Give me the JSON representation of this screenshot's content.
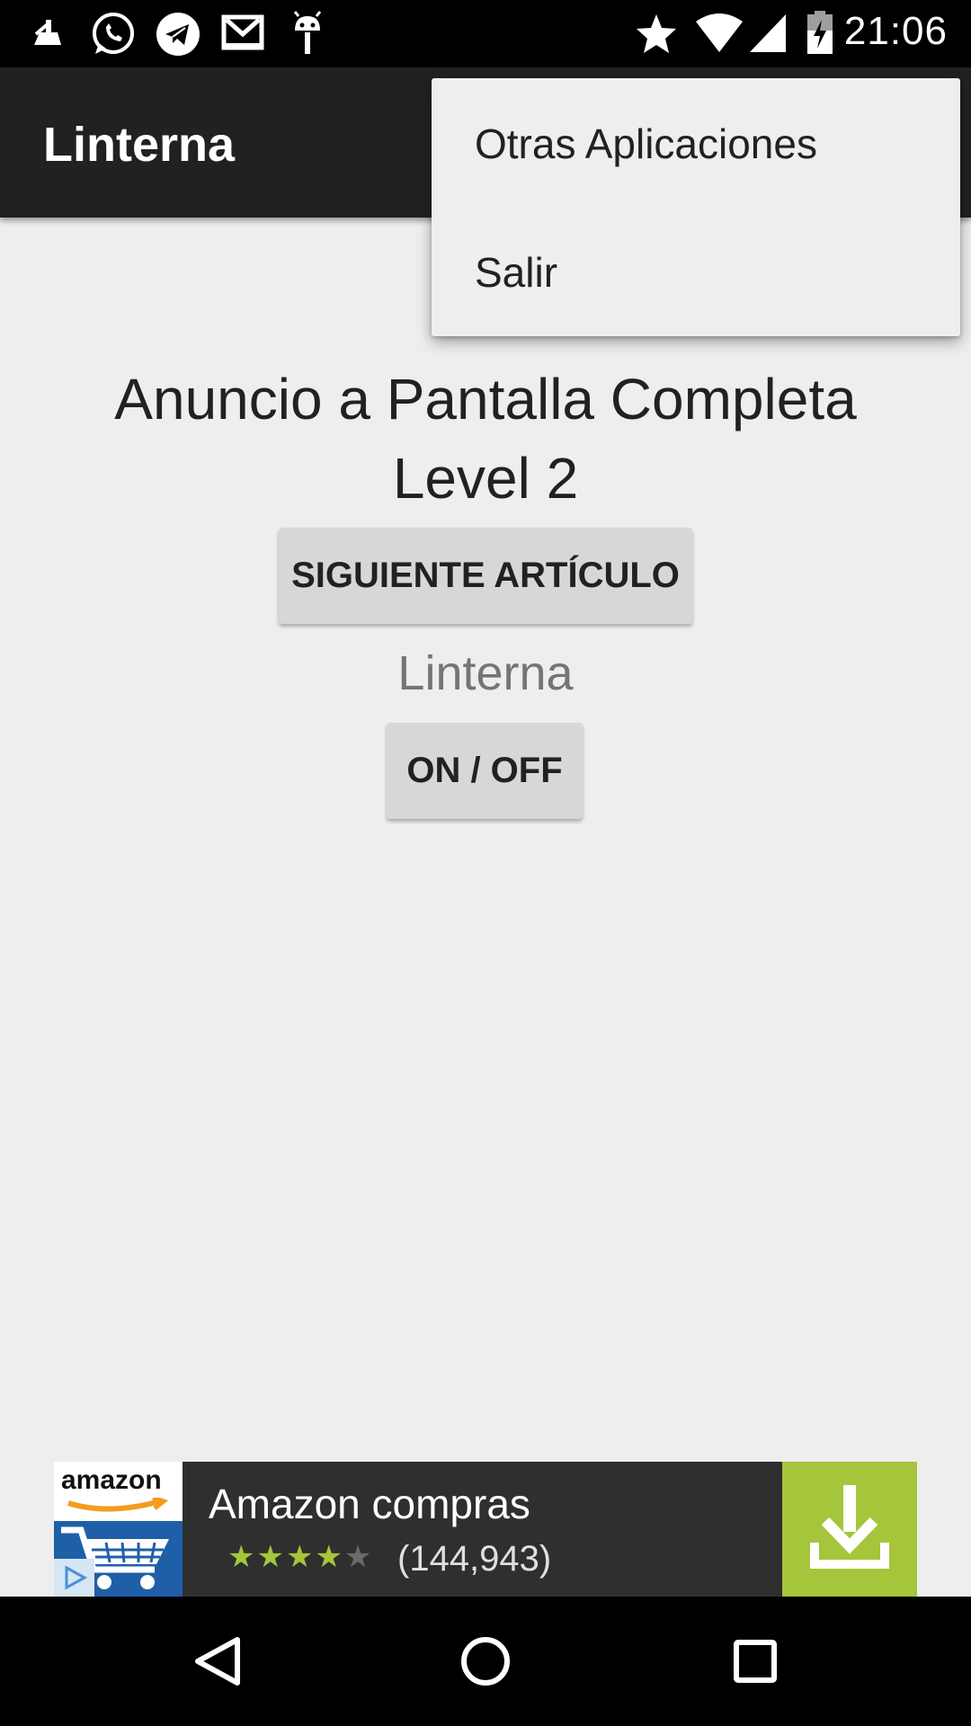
{
  "status_bar": {
    "time": "21:06",
    "left_icons": [
      "cleaner-icon",
      "whatsapp-icon",
      "telegram-icon",
      "gmail-icon",
      "android-debug-icon"
    ],
    "right_icons": [
      "star-icon",
      "wifi-icon",
      "cell-signal-icon",
      "battery-charging-icon"
    ]
  },
  "app_bar": {
    "title": "Linterna"
  },
  "content": {
    "headline_line1": "Anuncio a Pantalla Completa",
    "headline_line2": "Level 2",
    "next_button": "SIGUIENTE ARTÍCULO",
    "section_label": "Linterna",
    "onoff_button": "ON / OFF"
  },
  "menu": {
    "items": [
      {
        "label": "Otras Aplicaciones"
      },
      {
        "label": "Salir"
      }
    ]
  },
  "ad": {
    "logo_word": "amazon",
    "title": "Amazon compras",
    "rating_stars": 4,
    "rating_max": 5,
    "stars_filled": "★★★★",
    "stars_empty": "★",
    "rating_count": "(144,943)",
    "accent_color": "#a5c53a",
    "icons": [
      "amazon-cart-icon",
      "download-icon",
      "adchoices-icon"
    ]
  },
  "nav_bar": {
    "buttons": [
      "back-icon",
      "home-icon",
      "recents-icon"
    ]
  },
  "colors": {
    "status_bar": "#000000",
    "app_bar": "#212121",
    "background": "#eeeeee",
    "button": "#d6d7d7",
    "ad_background": "#2f2f2f"
  }
}
